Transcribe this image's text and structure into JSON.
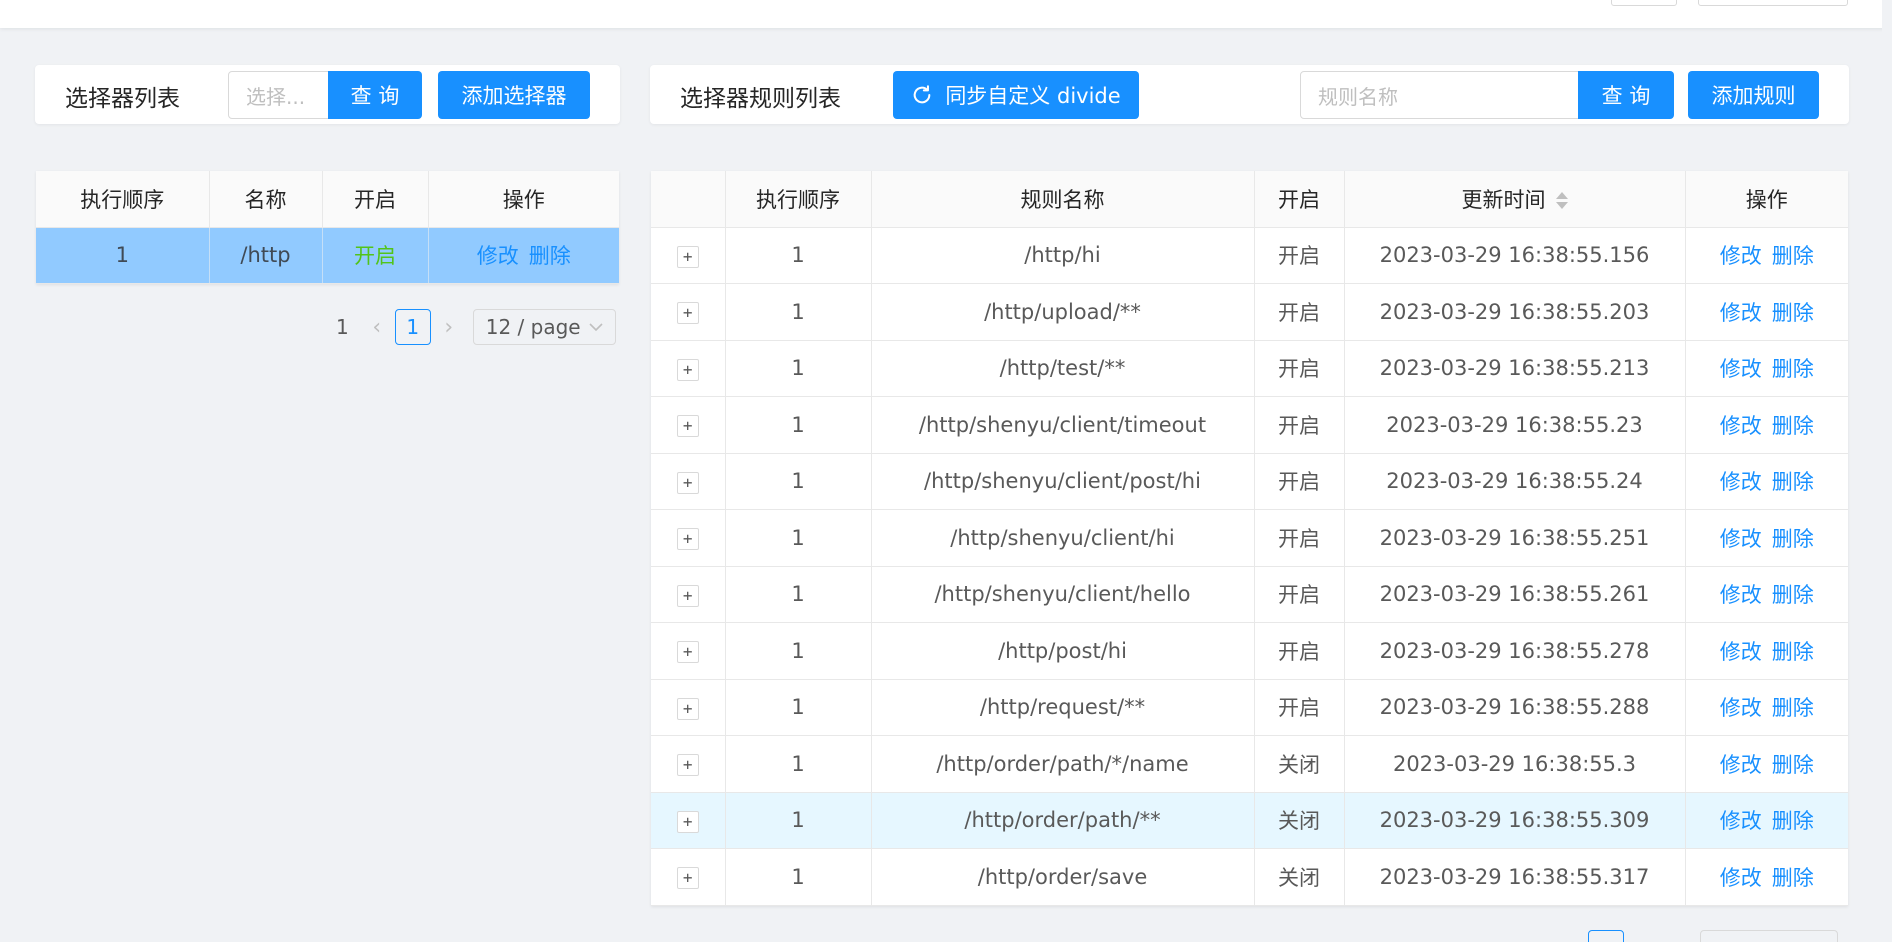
{
  "selector_panel": {
    "title": "选择器列表",
    "search_placeholder": "选择...",
    "query_label": "查 询",
    "add_label": "添加选择器",
    "columns": [
      "执行顺序",
      "名称",
      "开启",
      "操作"
    ],
    "rows": [
      {
        "order": "1",
        "name": "/http",
        "status": "开启",
        "edit": "修改",
        "delete": "删除"
      }
    ],
    "pagination": {
      "total": "1",
      "current": "1",
      "page_size": "12 / page"
    }
  },
  "rule_panel": {
    "title": "选择器规则列表",
    "sync_label": "同步自定义 divide",
    "search_placeholder": "规则名称",
    "query_label": "查 询",
    "add_label": "添加规则",
    "columns": [
      "",
      "执行顺序",
      "规则名称",
      "开启",
      "更新时间",
      "操作"
    ],
    "rows": [
      {
        "order": "1",
        "name": "/http/hi",
        "status": "开启",
        "time": "2023-03-29 16:38:55.156",
        "edit": "修改",
        "delete": "删除"
      },
      {
        "order": "1",
        "name": "/http/upload/**",
        "status": "开启",
        "time": "2023-03-29 16:38:55.203",
        "edit": "修改",
        "delete": "删除"
      },
      {
        "order": "1",
        "name": "/http/test/**",
        "status": "开启",
        "time": "2023-03-29 16:38:55.213",
        "edit": "修改",
        "delete": "删除"
      },
      {
        "order": "1",
        "name": "/http/shenyu/client/timeout",
        "status": "开启",
        "time": "2023-03-29 16:38:55.23",
        "edit": "修改",
        "delete": "删除"
      },
      {
        "order": "1",
        "name": "/http/shenyu/client/post/hi",
        "status": "开启",
        "time": "2023-03-29 16:38:55.24",
        "edit": "修改",
        "delete": "删除"
      },
      {
        "order": "1",
        "name": "/http/shenyu/client/hi",
        "status": "开启",
        "time": "2023-03-29 16:38:55.251",
        "edit": "修改",
        "delete": "删除"
      },
      {
        "order": "1",
        "name": "/http/shenyu/client/hello",
        "status": "开启",
        "time": "2023-03-29 16:38:55.261",
        "edit": "修改",
        "delete": "删除"
      },
      {
        "order": "1",
        "name": "/http/post/hi",
        "status": "开启",
        "time": "2023-03-29 16:38:55.278",
        "edit": "修改",
        "delete": "删除"
      },
      {
        "order": "1",
        "name": "/http/request/**",
        "status": "开启",
        "time": "2023-03-29 16:38:55.288",
        "edit": "修改",
        "delete": "删除"
      },
      {
        "order": "1",
        "name": "/http/order/path/*/name",
        "status": "关闭",
        "time": "2023-03-29 16:38:55.3",
        "edit": "修改",
        "delete": "删除"
      },
      {
        "order": "1",
        "name": "/http/order/path/**",
        "status": "关闭",
        "time": "2023-03-29 16:38:55.309",
        "edit": "修改",
        "delete": "删除"
      },
      {
        "order": "1",
        "name": "/http/order/save",
        "status": "关闭",
        "time": "2023-03-29 16:38:55.317",
        "edit": "修改",
        "delete": "删除"
      }
    ]
  },
  "colors": {
    "primary": "#1890ff",
    "enabled": "#52c41a",
    "disabled": "#f5222d",
    "selected_row": "#91caff"
  },
  "icons": {
    "sync": "sync-icon",
    "expand": "plus-square-icon",
    "sort": "sort-caret-icon"
  }
}
